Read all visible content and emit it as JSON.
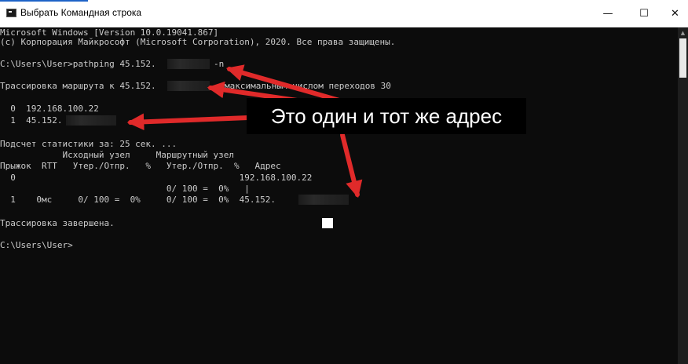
{
  "window": {
    "title": "Выбрать Командная строка",
    "minimize_glyph": "—",
    "maximize_glyph": "☐",
    "close_glyph": "✕"
  },
  "console": {
    "lines": {
      "version": "Microsoft Windows [Version 10.0.19041.867]",
      "copyright": "(c) Корпорация Майкрософт (Microsoft Corporation), 2020. Все права защищены.",
      "command": "C:\\Users\\User>pathping 45.152.",
      "command_suffix": "-n",
      "trace_prefix": "Трассировка маршрута к 45.152.",
      "trace_suffix": "максимальным числом переходов 30",
      "hop0": "  0  192.168.100.22",
      "hop1": "  1  45.152.",
      "stats_header": "Подсчет статистики за: 25 сек. ...",
      "col_header1": "            Исходный узел     Маршрутный узел",
      "col_header2": "Прыжок  RTT   Утер./Отпр.   %   Утер./Отпр.  %   Адрес",
      "stats_row0": "  0                                           192.168.100.22",
      "stats_row_link": "                                0/ 100 =  0%   |",
      "stats_row1": "  1    0мс     0/ 100 =  0%     0/ 100 =  0%  45.152.",
      "trace_done": "Трассировка завершена.",
      "prompt": "C:\\Users\\User>"
    }
  },
  "annotation": {
    "callout_text": "Это один и тот же адрес",
    "arrow_color": "#e02a2a"
  },
  "scrollbar": {
    "up_glyph": "▲"
  }
}
